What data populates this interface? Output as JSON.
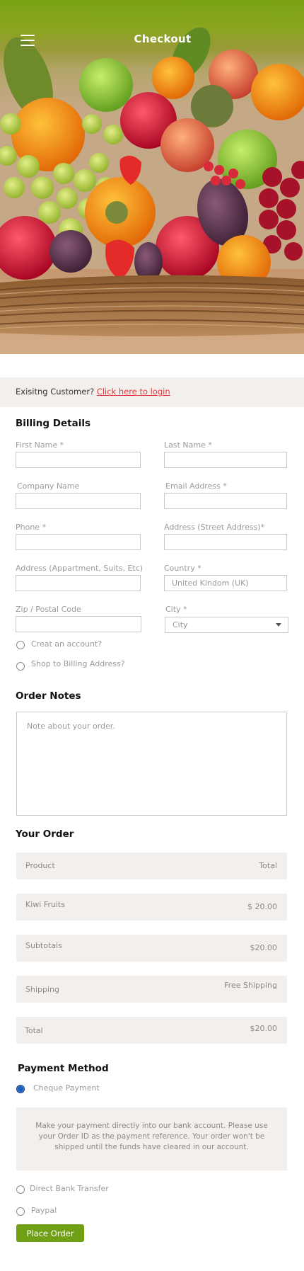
{
  "header": {
    "title": "Checkout",
    "menu_icon": "hamburger-menu-icon"
  },
  "login_prompt": {
    "text": "Exisitng Customer?",
    "link": "Click here to login"
  },
  "billing": {
    "title": "Billing Details",
    "fields": {
      "first_name": {
        "label": "First Name *",
        "value": ""
      },
      "last_name": {
        "label": "Last Name *",
        "value": ""
      },
      "company": {
        "label": "Company Name",
        "value": ""
      },
      "email": {
        "label": "Email Address *",
        "value": ""
      },
      "phone": {
        "label": "Phone *",
        "value": ""
      },
      "street": {
        "label": "Address (Street Address)*",
        "value": ""
      },
      "appartment": {
        "label": "Address (Appartment, Suits, Etc)",
        "value": ""
      },
      "country": {
        "label": "Country *",
        "value": "United  Kindom (UK)"
      },
      "zip": {
        "label": "Zip / Postal Code",
        "value": ""
      },
      "city": {
        "label": "City *",
        "selected": "City"
      }
    },
    "options": {
      "create_account": "Creat an account?",
      "ship_to_billing": "Shop to Billing Address?"
    }
  },
  "notes": {
    "title": "Order Notes",
    "placeholder": "Note about your order."
  },
  "order": {
    "title": "Your Order",
    "header": {
      "product": "Product",
      "total": "Total"
    },
    "items": [
      {
        "name": "Kiwi Fruits",
        "price": "$ 20.00"
      }
    ],
    "subtotal": {
      "label": "Subtotals",
      "value": "$20.00"
    },
    "shipping": {
      "label": "Shipping",
      "value": "Free Shipping"
    },
    "total": {
      "label": "Total",
      "value": "$20.00"
    }
  },
  "payment": {
    "title": "Payment Method",
    "methods": [
      "Cheque Payment",
      "Direct Bank Transfer",
      "Paypal"
    ],
    "selected": "Cheque Payment",
    "description": "Make your payment directly into our bank account. Please use your Order ID as the payment reference. Your order won't be shipped until the funds have cleared in our account.",
    "place_order": "Place Order"
  },
  "colors": {
    "accent": "#6fa016",
    "link": "#e03a3a",
    "panel": "#f3efed"
  }
}
